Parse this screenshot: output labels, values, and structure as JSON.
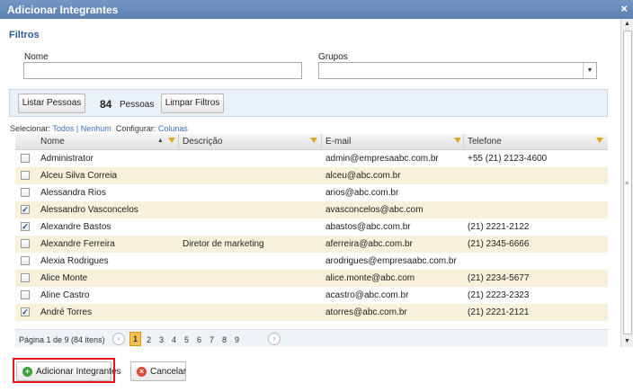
{
  "window": {
    "title": "Adicionar Integrantes",
    "close_symbol": "×"
  },
  "filters": {
    "section_title": "Filtros",
    "name_label": "Nome",
    "name_value": "",
    "groups_label": "Grupos",
    "groups_value": ""
  },
  "toolbar": {
    "list_button": "Listar Pessoas",
    "count": "84",
    "count_label": "Pessoas",
    "clear_button": "Limpar Filtros"
  },
  "selection": {
    "select_label": "Selecionar:",
    "all": "Todos",
    "separator": "|",
    "none": "Nenhum",
    "configure_label": "Configurar:",
    "columns": "Colunas"
  },
  "grid": {
    "columns": [
      "Nome",
      "Descrição",
      "E-mail",
      "Telefone"
    ],
    "rows": [
      {
        "checked": false,
        "name": "Administrator",
        "description": "",
        "email": "admin@empresaabc.com.br",
        "phone": "+55 (21) 2123-4600"
      },
      {
        "checked": false,
        "name": "Alceu Silva Correia",
        "description": "",
        "email": "alceu@abc.com.br",
        "phone": ""
      },
      {
        "checked": false,
        "name": "Alessandra Rios",
        "description": "",
        "email": "arios@abc.com.br",
        "phone": ""
      },
      {
        "checked": true,
        "name": "Alessandro Vasconcelos",
        "description": "",
        "email": "avasconcelos@abc.com",
        "phone": ""
      },
      {
        "checked": true,
        "name": "Alexandre Bastos",
        "description": "",
        "email": "abastos@abc.com.br",
        "phone": "(21) 2221-2122"
      },
      {
        "checked": false,
        "name": "Alexandre Ferreira",
        "description": "Diretor de marketing",
        "email": "aferreira@abc.com.br",
        "phone": "(21) 2345-6666"
      },
      {
        "checked": false,
        "name": "Alexia Rodrigues",
        "description": "",
        "email": "arodrigues@empresaabc.com.br",
        "phone": ""
      },
      {
        "checked": false,
        "name": "Alice Monte",
        "description": "",
        "email": "alice.monte@abc.com",
        "phone": "(21) 2234-5677"
      },
      {
        "checked": false,
        "name": "Aline Castro",
        "description": "",
        "email": "acastro@abc.com.br",
        "phone": "(21) 2223-2323"
      },
      {
        "checked": true,
        "name": "André Torres",
        "description": "",
        "email": "atorres@abc.com.br",
        "phone": "(21) 2221-2121"
      }
    ],
    "check_mark": "✓"
  },
  "pager": {
    "info": "Página 1 de 9 (84 itens)",
    "prev": "‹",
    "next": "›",
    "pages": [
      "1",
      "2",
      "3",
      "4",
      "5",
      "6",
      "7",
      "8",
      "9"
    ],
    "current": "1"
  },
  "footer": {
    "add_button": "Adicionar Integrantes",
    "cancel_button": "Cancelar"
  },
  "colors": {
    "title_bar": "#5b7fb0",
    "accent_blue": "#2d5d9d",
    "stripe": "#f7f0da",
    "current_page": "#f6c14a",
    "highlight_red": "#e8141d",
    "add_icon": "#3ea03a",
    "cancel_icon": "#d94a3a"
  },
  "icons": {
    "close": "close-icon",
    "filter": "filter-icon",
    "sort": "sort-ascending-icon",
    "add": "plus-circle-icon",
    "cancel": "cancel-circle-icon"
  }
}
